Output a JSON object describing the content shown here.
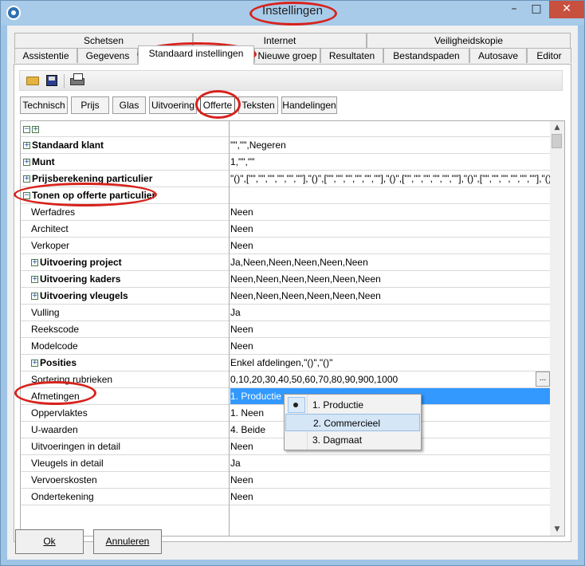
{
  "window": {
    "title": "Instellingen",
    "minimize_glyph": "–",
    "maximize_glyph": "□",
    "close_glyph": "✕"
  },
  "tabs": {
    "row1": [
      "Schetsen",
      "Internet",
      "Veiligheidskopie"
    ],
    "row2": [
      "Assistentie",
      "Gegevens",
      "Standaard instellingen",
      "Nieuwe groep",
      "Resultaten",
      "Bestandspaden",
      "Autosave",
      "Editor"
    ],
    "active": "Standaard instellingen"
  },
  "toolbar": {
    "icons": [
      "open-folder-icon",
      "save-icon",
      "print-icon"
    ]
  },
  "subtabs": {
    "items": [
      "Technisch",
      "Prijs",
      "Glas",
      "Uitvoering",
      "Offerte",
      "Teksten",
      "Handelingen"
    ],
    "active": "Offerte"
  },
  "grid": {
    "header_controls": [
      "−",
      "+"
    ],
    "rows": [
      {
        "name": "Standaard klant",
        "value": "\"\",\"\",Negeren",
        "level": 0,
        "bold": true,
        "expander": "+"
      },
      {
        "name": "Munt",
        "value": "1,\"\",\"\"",
        "level": 0,
        "bold": true,
        "expander": "+"
      },
      {
        "name": "Prijsberekening particulier",
        "value": "\"()\",[\"\",\"\",\"\",\"\",\"\",\"\"],\"()\",[\"\",\"\",\"\",\"\",\"\",\"\"],\"()\",[\"\",\"\",\"\",\"\",\"\",\"\"],\"()\",[\"\",\"\",\"\",\"\",\"\",\"\"],\"()\",[\"\",\"\",\"\"",
        "level": 0,
        "bold": true,
        "expander": "+"
      },
      {
        "name": "Tonen op offerte particulier",
        "value": "",
        "level": 0,
        "bold": true,
        "expander": "−"
      },
      {
        "name": "Werfadres",
        "value": "Neen",
        "level": 1,
        "bold": false,
        "expander": ""
      },
      {
        "name": "Architect",
        "value": "Neen",
        "level": 1,
        "bold": false,
        "expander": ""
      },
      {
        "name": "Verkoper",
        "value": "Neen",
        "level": 1,
        "bold": false,
        "expander": ""
      },
      {
        "name": "Uitvoering project",
        "value": "Ja,Neen,Neen,Neen,Neen,Neen",
        "level": 1,
        "bold": true,
        "expander": "+"
      },
      {
        "name": "Uitvoering kaders",
        "value": "Neen,Neen,Neen,Neen,Neen,Neen",
        "level": 1,
        "bold": true,
        "expander": "+"
      },
      {
        "name": "Uitvoering vleugels",
        "value": "Neen,Neen,Neen,Neen,Neen,Neen",
        "level": 1,
        "bold": true,
        "expander": "+"
      },
      {
        "name": "Vulling",
        "value": "Ja",
        "level": 1,
        "bold": false,
        "expander": ""
      },
      {
        "name": "Reekscode",
        "value": "Neen",
        "level": 1,
        "bold": false,
        "expander": ""
      },
      {
        "name": "Modelcode",
        "value": "Neen",
        "level": 1,
        "bold": false,
        "expander": ""
      },
      {
        "name": "Posities",
        "value": "Enkel afdelingen,\"()\",\"()\"",
        "level": 1,
        "bold": true,
        "expander": "+"
      },
      {
        "name": "Sortering rubrieken",
        "value": "0,10,20,30,40,50,60,70,80,90,900,1000",
        "level": 1,
        "bold": false,
        "expander": "",
        "ellipsis": "..."
      },
      {
        "name": "Afmetingen",
        "value": "1. Productie",
        "level": 1,
        "bold": false,
        "expander": "",
        "selected": true
      },
      {
        "name": "Oppervlaktes",
        "value": "1. Neen",
        "level": 1,
        "bold": false,
        "expander": ""
      },
      {
        "name": "U-waarden",
        "value": "4. Beide",
        "level": 1,
        "bold": false,
        "expander": ""
      },
      {
        "name": "Uitvoeringen in detail",
        "value": "Neen",
        "level": 1,
        "bold": false,
        "expander": ""
      },
      {
        "name": "Vleugels in detail",
        "value": "Ja",
        "level": 1,
        "bold": false,
        "expander": ""
      },
      {
        "name": "Vervoerskosten",
        "value": "Neen",
        "level": 1,
        "bold": false,
        "expander": ""
      },
      {
        "name": "Ondertekening",
        "value": "Neen",
        "level": 1,
        "bold": false,
        "expander": ""
      }
    ],
    "scroll_up_glyph": "▲",
    "scroll_down_glyph": "▼"
  },
  "dropdown": {
    "options": [
      "1. Productie",
      "2. Commercieel",
      "3. Dagmaat"
    ],
    "checked_index": 0,
    "highlighted_index": 1
  },
  "buttons": {
    "ok": "Ok",
    "cancel": "Annuleren"
  },
  "colors": {
    "selection": "#3399ff",
    "annotation_red": "#d7231d",
    "titlebar": "#a8cbe9",
    "close_button": "#c7503f"
  }
}
